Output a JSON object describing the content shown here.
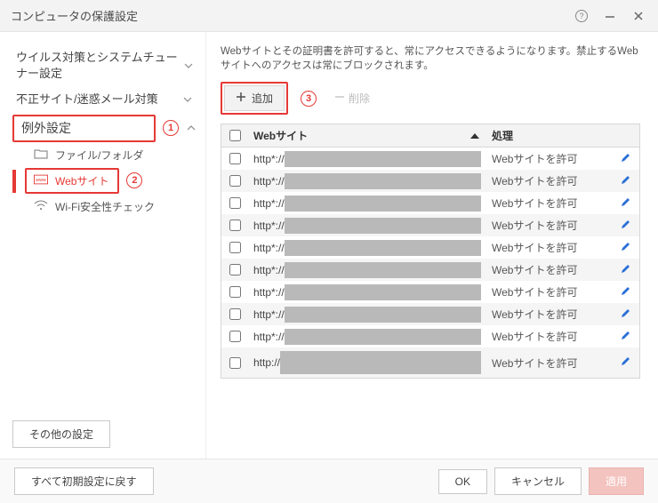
{
  "window": {
    "title": "コンピュータの保護設定"
  },
  "sidebar": {
    "groups": [
      {
        "label": "ウイルス対策とシステムチューナー設定"
      },
      {
        "label": "不正サイト/迷惑メール対策"
      },
      {
        "label": "例外設定"
      }
    ],
    "sub": {
      "file_folder": "ファイル/フォルダ",
      "website": "Webサイト",
      "wifi": "Wi-Fi安全性チェック"
    },
    "other_settings": "その他の設定",
    "annotations": {
      "one": "1",
      "two": "2",
      "three": "3"
    }
  },
  "main": {
    "description": "Webサイトとその証明書を許可すると、常にアクセスできるようになります。禁止するWebサイトへのアクセスは常にブロックされます。",
    "add_label": "追加",
    "delete_label": "削除",
    "columns": {
      "site": "Webサイト",
      "action": "処理"
    },
    "rows": [
      {
        "prefix": "http*://",
        "action": "Webサイトを許可"
      },
      {
        "prefix": "http*://",
        "action": "Webサイトを許可"
      },
      {
        "prefix": "http*://",
        "action": "Webサイトを許可"
      },
      {
        "prefix": "http*://",
        "action": "Webサイトを許可"
      },
      {
        "prefix": "http*://",
        "action": "Webサイトを許可"
      },
      {
        "prefix": "http*://",
        "action": "Webサイトを許可"
      },
      {
        "prefix": "http*://",
        "action": "Webサイトを許可"
      },
      {
        "prefix": "http*://",
        "action": "Webサイトを許可"
      },
      {
        "prefix": "http*://",
        "action": "Webサイトを許可"
      },
      {
        "prefix": "http://",
        "action": "Webサイトを許可"
      }
    ]
  },
  "footer": {
    "reset": "すべて初期設定に戻す",
    "ok": "OK",
    "cancel": "キャンセル",
    "apply": "適用"
  }
}
